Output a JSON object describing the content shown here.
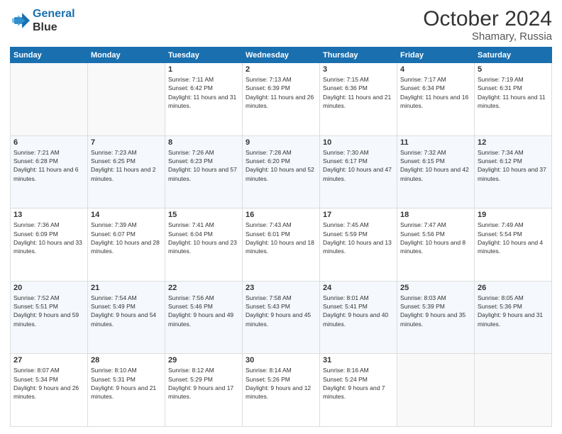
{
  "logo": {
    "line1": "General",
    "line2": "Blue"
  },
  "header": {
    "month": "October 2024",
    "location": "Shamary, Russia"
  },
  "weekdays": [
    "Sunday",
    "Monday",
    "Tuesday",
    "Wednesday",
    "Thursday",
    "Friday",
    "Saturday"
  ],
  "weeks": [
    [
      {
        "day": "",
        "info": ""
      },
      {
        "day": "",
        "info": ""
      },
      {
        "day": "1",
        "info": "Sunrise: 7:11 AM\nSunset: 6:42 PM\nDaylight: 11 hours and 31 minutes."
      },
      {
        "day": "2",
        "info": "Sunrise: 7:13 AM\nSunset: 6:39 PM\nDaylight: 11 hours and 26 minutes."
      },
      {
        "day": "3",
        "info": "Sunrise: 7:15 AM\nSunset: 6:36 PM\nDaylight: 11 hours and 21 minutes."
      },
      {
        "day": "4",
        "info": "Sunrise: 7:17 AM\nSunset: 6:34 PM\nDaylight: 11 hours and 16 minutes."
      },
      {
        "day": "5",
        "info": "Sunrise: 7:19 AM\nSunset: 6:31 PM\nDaylight: 11 hours and 11 minutes."
      }
    ],
    [
      {
        "day": "6",
        "info": "Sunrise: 7:21 AM\nSunset: 6:28 PM\nDaylight: 11 hours and 6 minutes."
      },
      {
        "day": "7",
        "info": "Sunrise: 7:23 AM\nSunset: 6:25 PM\nDaylight: 11 hours and 2 minutes."
      },
      {
        "day": "8",
        "info": "Sunrise: 7:26 AM\nSunset: 6:23 PM\nDaylight: 10 hours and 57 minutes."
      },
      {
        "day": "9",
        "info": "Sunrise: 7:28 AM\nSunset: 6:20 PM\nDaylight: 10 hours and 52 minutes."
      },
      {
        "day": "10",
        "info": "Sunrise: 7:30 AM\nSunset: 6:17 PM\nDaylight: 10 hours and 47 minutes."
      },
      {
        "day": "11",
        "info": "Sunrise: 7:32 AM\nSunset: 6:15 PM\nDaylight: 10 hours and 42 minutes."
      },
      {
        "day": "12",
        "info": "Sunrise: 7:34 AM\nSunset: 6:12 PM\nDaylight: 10 hours and 37 minutes."
      }
    ],
    [
      {
        "day": "13",
        "info": "Sunrise: 7:36 AM\nSunset: 6:09 PM\nDaylight: 10 hours and 33 minutes."
      },
      {
        "day": "14",
        "info": "Sunrise: 7:39 AM\nSunset: 6:07 PM\nDaylight: 10 hours and 28 minutes."
      },
      {
        "day": "15",
        "info": "Sunrise: 7:41 AM\nSunset: 6:04 PM\nDaylight: 10 hours and 23 minutes."
      },
      {
        "day": "16",
        "info": "Sunrise: 7:43 AM\nSunset: 6:01 PM\nDaylight: 10 hours and 18 minutes."
      },
      {
        "day": "17",
        "info": "Sunrise: 7:45 AM\nSunset: 5:59 PM\nDaylight: 10 hours and 13 minutes."
      },
      {
        "day": "18",
        "info": "Sunrise: 7:47 AM\nSunset: 5:56 PM\nDaylight: 10 hours and 8 minutes."
      },
      {
        "day": "19",
        "info": "Sunrise: 7:49 AM\nSunset: 5:54 PM\nDaylight: 10 hours and 4 minutes."
      }
    ],
    [
      {
        "day": "20",
        "info": "Sunrise: 7:52 AM\nSunset: 5:51 PM\nDaylight: 9 hours and 59 minutes."
      },
      {
        "day": "21",
        "info": "Sunrise: 7:54 AM\nSunset: 5:49 PM\nDaylight: 9 hours and 54 minutes."
      },
      {
        "day": "22",
        "info": "Sunrise: 7:56 AM\nSunset: 5:46 PM\nDaylight: 9 hours and 49 minutes."
      },
      {
        "day": "23",
        "info": "Sunrise: 7:58 AM\nSunset: 5:43 PM\nDaylight: 9 hours and 45 minutes."
      },
      {
        "day": "24",
        "info": "Sunrise: 8:01 AM\nSunset: 5:41 PM\nDaylight: 9 hours and 40 minutes."
      },
      {
        "day": "25",
        "info": "Sunrise: 8:03 AM\nSunset: 5:39 PM\nDaylight: 9 hours and 35 minutes."
      },
      {
        "day": "26",
        "info": "Sunrise: 8:05 AM\nSunset: 5:36 PM\nDaylight: 9 hours and 31 minutes."
      }
    ],
    [
      {
        "day": "27",
        "info": "Sunrise: 8:07 AM\nSunset: 5:34 PM\nDaylight: 9 hours and 26 minutes."
      },
      {
        "day": "28",
        "info": "Sunrise: 8:10 AM\nSunset: 5:31 PM\nDaylight: 9 hours and 21 minutes."
      },
      {
        "day": "29",
        "info": "Sunrise: 8:12 AM\nSunset: 5:29 PM\nDaylight: 9 hours and 17 minutes."
      },
      {
        "day": "30",
        "info": "Sunrise: 8:14 AM\nSunset: 5:26 PM\nDaylight: 9 hours and 12 minutes."
      },
      {
        "day": "31",
        "info": "Sunrise: 8:16 AM\nSunset: 5:24 PM\nDaylight: 9 hours and 7 minutes."
      },
      {
        "day": "",
        "info": ""
      },
      {
        "day": "",
        "info": ""
      }
    ]
  ]
}
